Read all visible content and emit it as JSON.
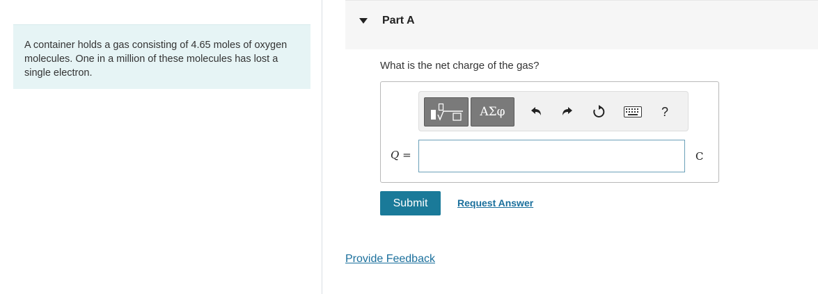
{
  "problem": {
    "text": "A container holds a gas consisting of 4.65 moles of oxygen molecules. One in a million of these molecules has lost a single electron."
  },
  "part": {
    "title": "Part A",
    "question": "What is the net charge of the gas?"
  },
  "toolbar": {
    "template_icon": "templates-icon",
    "greek_label": "ΑΣφ",
    "undo_icon": "undo-icon",
    "redo_icon": "redo-icon",
    "reset_icon": "reset-icon",
    "keyboard_icon": "keyboard-icon",
    "help_label": "?"
  },
  "answer": {
    "variable": "Q",
    "equals": "=",
    "value": "",
    "unit": "C"
  },
  "actions": {
    "submit_label": "Submit",
    "request_answer_label": "Request Answer"
  },
  "footer": {
    "feedback_label": "Provide Feedback"
  },
  "colors": {
    "problem_bg": "#e6f4f5",
    "submit_bg": "#1a7a99",
    "link": "#1a6f9c"
  }
}
